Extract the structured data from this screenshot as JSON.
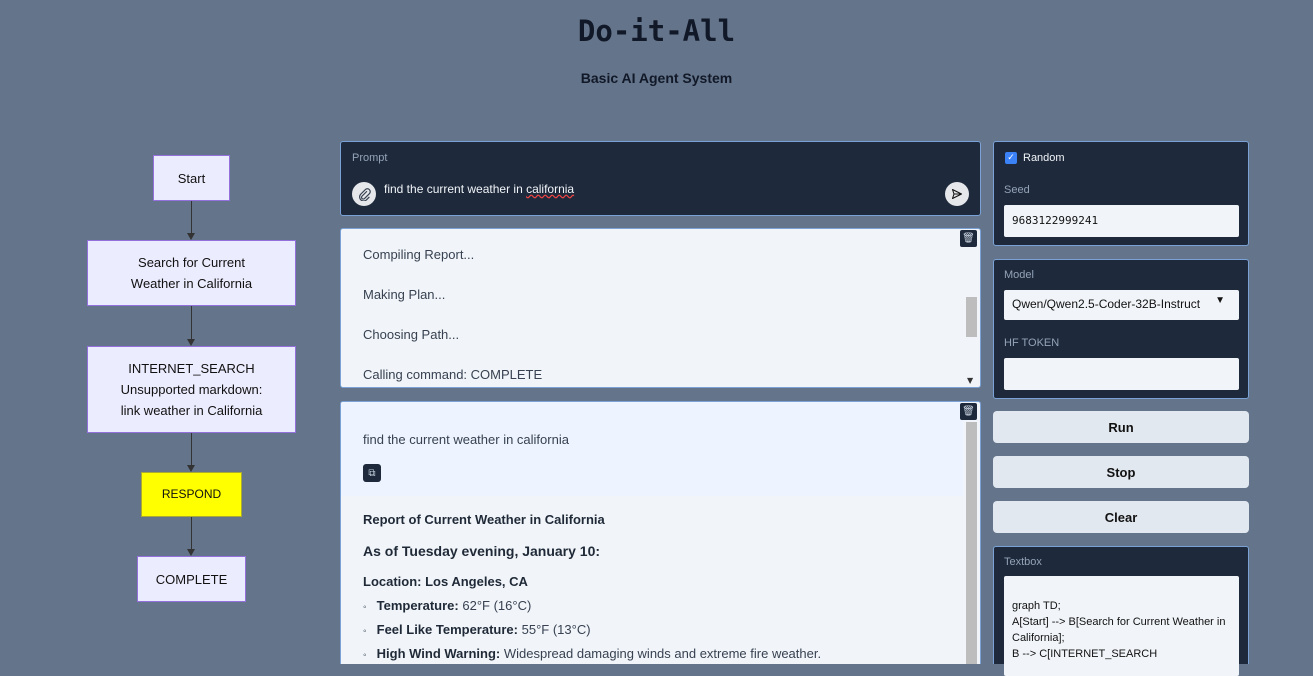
{
  "header": {
    "title": "Do-it-All",
    "subtitle": "Basic AI Agent System"
  },
  "flowchart": {
    "nodes": [
      {
        "id": "start",
        "lines": [
          "Start"
        ]
      },
      {
        "id": "search",
        "lines": [
          "Search for Current",
          "Weather in California"
        ]
      },
      {
        "id": "internet",
        "lines": [
          "INTERNET_SEARCH",
          "Unsupported markdown:",
          "link weather in California"
        ]
      },
      {
        "id": "respond",
        "lines": [
          "RESPOND"
        ]
      },
      {
        "id": "complete",
        "lines": [
          "COMPLETE"
        ]
      }
    ],
    "colors": {
      "node_fill": "#ECECFF",
      "node_border": "#9370DB",
      "highlight": "#ffff00"
    }
  },
  "prompt": {
    "label": "Prompt",
    "value_prefix": "find the current weather in ",
    "value_misspelled": "california",
    "attach_icon": "paperclip-icon",
    "send_icon": "send-icon"
  },
  "log": {
    "items": [
      "Compiling Report...",
      "Making Plan...",
      "Choosing Path...",
      "Calling command: COMPLETE"
    ]
  },
  "chat": {
    "user_message": "find the current weather in california",
    "report_title": "Report of Current Weather in California",
    "report_heading": "As of Tuesday evening, January 10:",
    "location_label": "Location: Los Angeles, CA",
    "bullets": [
      {
        "label": "Temperature:",
        "value": "62°F (16°C)"
      },
      {
        "label": "Feel Like Temperature:",
        "value": "55°F (13°C)"
      },
      {
        "label": "High Wind Warning:",
        "value": "Widespread damaging winds and extreme fire weather."
      }
    ]
  },
  "settings": {
    "random_label": "Random",
    "random_checked": true,
    "seed_label": "Seed",
    "seed_value": "9683122999241",
    "model_label": "Model",
    "model_value": "Qwen/Qwen2.5-Coder-32B-Instruct",
    "hf_token_label": "HF TOKEN",
    "hf_token_value": ""
  },
  "buttons": {
    "run": "Run",
    "stop": "Stop",
    "clear": "Clear"
  },
  "textbox": {
    "label": "Textbox",
    "lines": [
      "graph TD;",
      "    A[Start] --> B[Search for Current Weather in California];",
      "    B --> C[INTERNET_SEARCH"
    ]
  },
  "colors": {
    "background": "#64748b",
    "panel": "#1e293b",
    "panel_border": "#7aa2d6",
    "accent": "#3b82f6"
  }
}
